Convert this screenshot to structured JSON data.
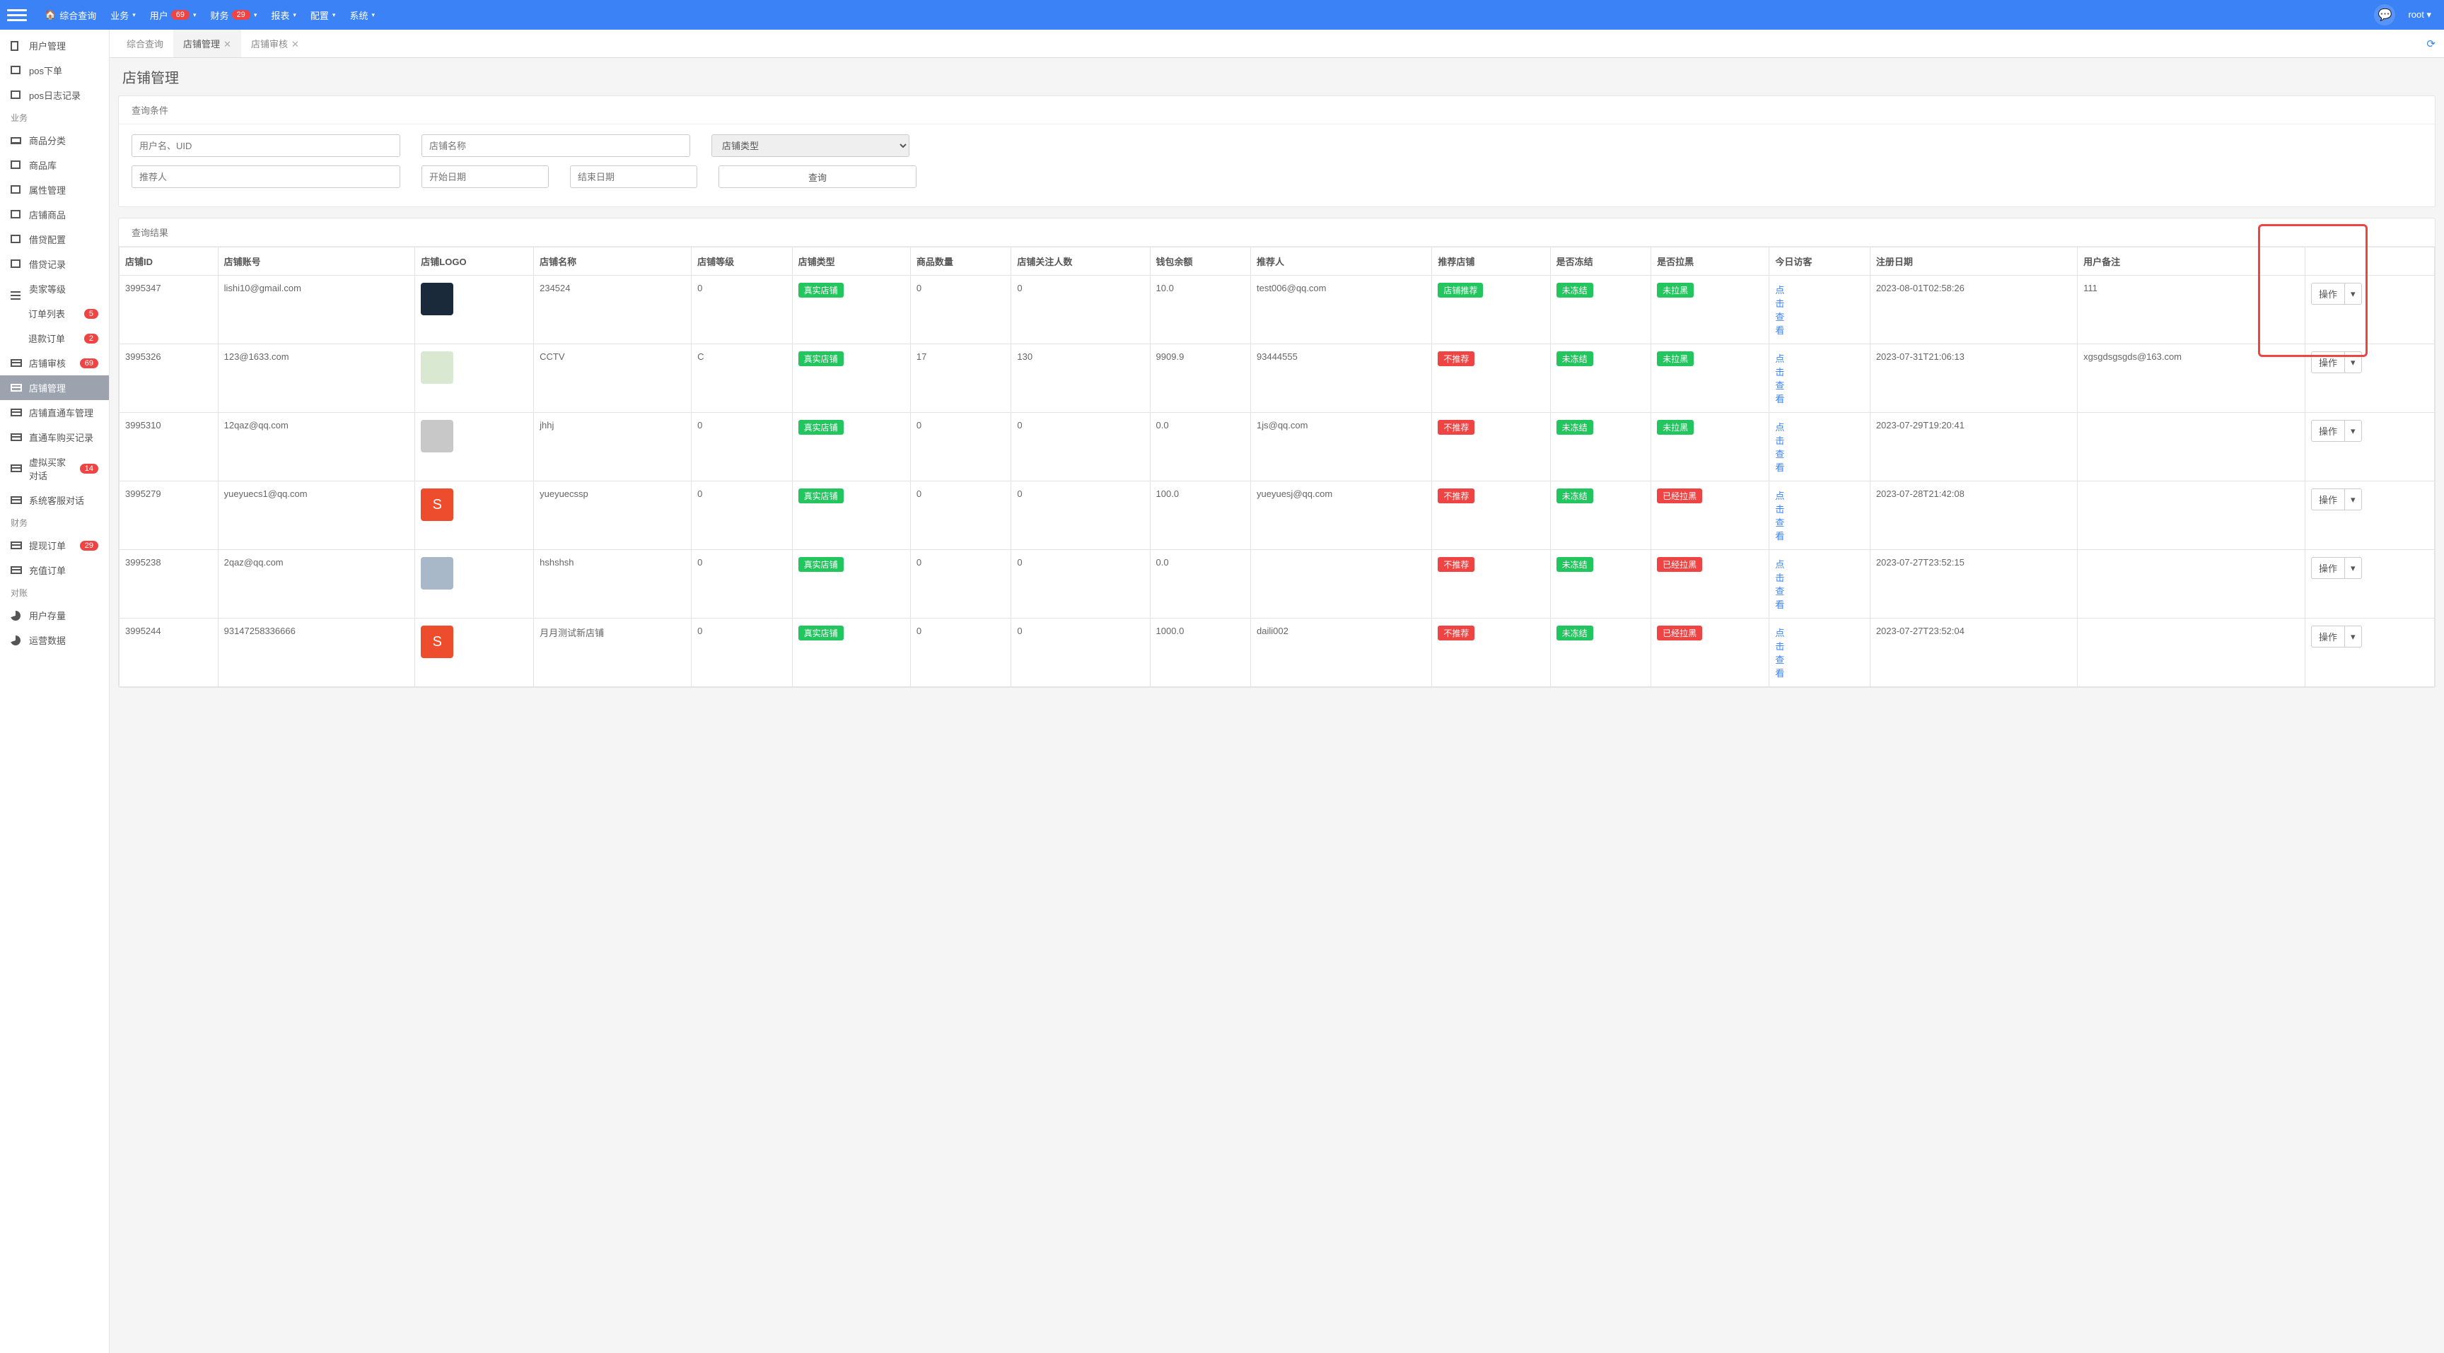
{
  "topnav": {
    "home": "综合查询",
    "items": [
      {
        "label": "业务"
      },
      {
        "label": "用户",
        "badge": "69"
      },
      {
        "label": "财务",
        "badge": "29"
      },
      {
        "label": "报表"
      },
      {
        "label": "配置"
      },
      {
        "label": "系统"
      }
    ],
    "user": "root"
  },
  "sidebar": {
    "items": [
      {
        "type": "item",
        "label": "用户管理",
        "icon": "file"
      },
      {
        "type": "item",
        "label": "pos下单",
        "icon": "box"
      },
      {
        "type": "item",
        "label": "pos日志记录",
        "icon": "box"
      },
      {
        "type": "group",
        "label": "业务"
      },
      {
        "type": "item",
        "label": "商品分类",
        "icon": "laptop"
      },
      {
        "type": "item",
        "label": "商品库",
        "icon": "box"
      },
      {
        "type": "item",
        "label": "属性管理",
        "icon": "box"
      },
      {
        "type": "item",
        "label": "店铺商品",
        "icon": "box"
      },
      {
        "type": "item",
        "label": "借贷配置",
        "icon": "box"
      },
      {
        "type": "item",
        "label": "借贷记录",
        "icon": "box"
      },
      {
        "type": "item",
        "label": "卖家等级",
        "icon": "list"
      },
      {
        "type": "sub",
        "label": "订单列表",
        "badge": "5"
      },
      {
        "type": "sub",
        "label": "退款订单",
        "badge": "2"
      },
      {
        "type": "item",
        "label": "店铺审核",
        "icon": "card",
        "badge": "69"
      },
      {
        "type": "item",
        "label": "店铺管理",
        "icon": "card",
        "active": true
      },
      {
        "type": "item",
        "label": "店铺直通车管理",
        "icon": "card"
      },
      {
        "type": "item",
        "label": "直通车购买记录",
        "icon": "card"
      },
      {
        "type": "item",
        "label": "虚拟买家对话",
        "icon": "card",
        "badge": "14"
      },
      {
        "type": "item",
        "label": "系统客服对话",
        "icon": "card"
      },
      {
        "type": "group",
        "label": "财务"
      },
      {
        "type": "item",
        "label": "提现订单",
        "icon": "card",
        "badge": "29"
      },
      {
        "type": "item",
        "label": "充值订单",
        "icon": "card"
      },
      {
        "type": "group",
        "label": "对账"
      },
      {
        "type": "item",
        "label": "用户存量",
        "icon": "pie"
      },
      {
        "type": "item",
        "label": "运营数据",
        "icon": "pie"
      }
    ]
  },
  "tabs": [
    {
      "label": "综合查询"
    },
    {
      "label": "店铺管理",
      "active": true,
      "closable": true
    },
    {
      "label": "店铺审核",
      "closable": true
    }
  ],
  "page_title": "店铺管理",
  "filter": {
    "panel_title": "查询条件",
    "user_placeholder": "用户名、UID",
    "shopname_placeholder": "店铺名称",
    "shoptype_placeholder": "店铺类型",
    "referrer_placeholder": "推荐人",
    "start_placeholder": "开始日期",
    "end_placeholder": "结束日期",
    "query_btn": "查询"
  },
  "results": {
    "panel_title": "查询结果",
    "columns": [
      "店铺ID",
      "店铺账号",
      "店铺LOGO",
      "店铺名称",
      "店铺等级",
      "店铺类型",
      "商品数量",
      "店铺关注人数",
      "钱包余额",
      "推荐人",
      "推荐店铺",
      "是否冻结",
      "是否拉黑",
      "今日访客",
      "注册日期",
      "用户备注",
      ""
    ],
    "visitor_link": "点击查看",
    "op_label": "操作",
    "rows": [
      {
        "id": "3995347",
        "account": "lishi10@gmail.com",
        "logo_color": "#1a2a3a",
        "name": "234524",
        "level": "0",
        "type": "真实店铺",
        "goods": "0",
        "fans": "0",
        "wallet": "10.0",
        "referrer": "test006@qq.com",
        "recommend": {
          "text": "店铺推荐",
          "cls": "tag-green"
        },
        "frozen": {
          "text": "未冻结",
          "cls": "tag-green"
        },
        "black": {
          "text": "未拉黑",
          "cls": "tag-green"
        },
        "reg": "2023-08-01T02:58:26",
        "remark": "111"
      },
      {
        "id": "3995326",
        "account": "123@1633.com",
        "logo_color": "#d9e8d0",
        "name": "CCTV",
        "level": "C",
        "type": "真实店铺",
        "goods": "17",
        "fans": "130",
        "wallet": "9909.9",
        "referrer": "93444555",
        "recommend": {
          "text": "不推荐",
          "cls": "tag-red"
        },
        "frozen": {
          "text": "未冻结",
          "cls": "tag-green"
        },
        "black": {
          "text": "未拉黑",
          "cls": "tag-green"
        },
        "reg": "2023-07-31T21:06:13",
        "remark": "xgsgdsgsgds@163.com"
      },
      {
        "id": "3995310",
        "account": "12qaz@qq.com",
        "logo_color": "#c8c8c8",
        "name": "jhhj",
        "level": "0",
        "type": "真实店铺",
        "goods": "0",
        "fans": "0",
        "wallet": "0.0",
        "referrer": "1js@qq.com",
        "recommend": {
          "text": "不推荐",
          "cls": "tag-red"
        },
        "frozen": {
          "text": "未冻结",
          "cls": "tag-green"
        },
        "black": {
          "text": "未拉黑",
          "cls": "tag-green"
        },
        "reg": "2023-07-29T19:20:41",
        "remark": ""
      },
      {
        "id": "3995279",
        "account": "yueyuecs1@qq.com",
        "logo_color": "#ee4d2d",
        "logo_text": "S",
        "name": "yueyuecssp",
        "level": "0",
        "type": "真实店铺",
        "goods": "0",
        "fans": "0",
        "wallet": "100.0",
        "referrer": "yueyuesj@qq.com",
        "recommend": {
          "text": "不推荐",
          "cls": "tag-red"
        },
        "frozen": {
          "text": "未冻结",
          "cls": "tag-green"
        },
        "black": {
          "text": "已经拉黑",
          "cls": "tag-red"
        },
        "reg": "2023-07-28T21:42:08",
        "remark": ""
      },
      {
        "id": "3995238",
        "account": "2qaz@qq.com",
        "logo_color": "#a8b8c8",
        "name": "hshshsh",
        "level": "0",
        "type": "真实店铺",
        "goods": "0",
        "fans": "0",
        "wallet": "0.0",
        "referrer": "",
        "recommend": {
          "text": "不推荐",
          "cls": "tag-red"
        },
        "frozen": {
          "text": "未冻结",
          "cls": "tag-green"
        },
        "black": {
          "text": "已经拉黑",
          "cls": "tag-red"
        },
        "reg": "2023-07-27T23:52:15",
        "remark": ""
      },
      {
        "id": "3995244",
        "account": "93147258336666",
        "logo_color": "#ee4d2d",
        "logo_text": "S",
        "name": "月月测试新店铺",
        "level": "0",
        "type": "真实店铺",
        "goods": "0",
        "fans": "0",
        "wallet": "1000.0",
        "referrer": "daili002",
        "recommend": {
          "text": "不推荐",
          "cls": "tag-red"
        },
        "frozen": {
          "text": "未冻结",
          "cls": "tag-green"
        },
        "black": {
          "text": "已经拉黑",
          "cls": "tag-red"
        },
        "reg": "2023-07-27T23:52:04",
        "remark": ""
      }
    ]
  }
}
